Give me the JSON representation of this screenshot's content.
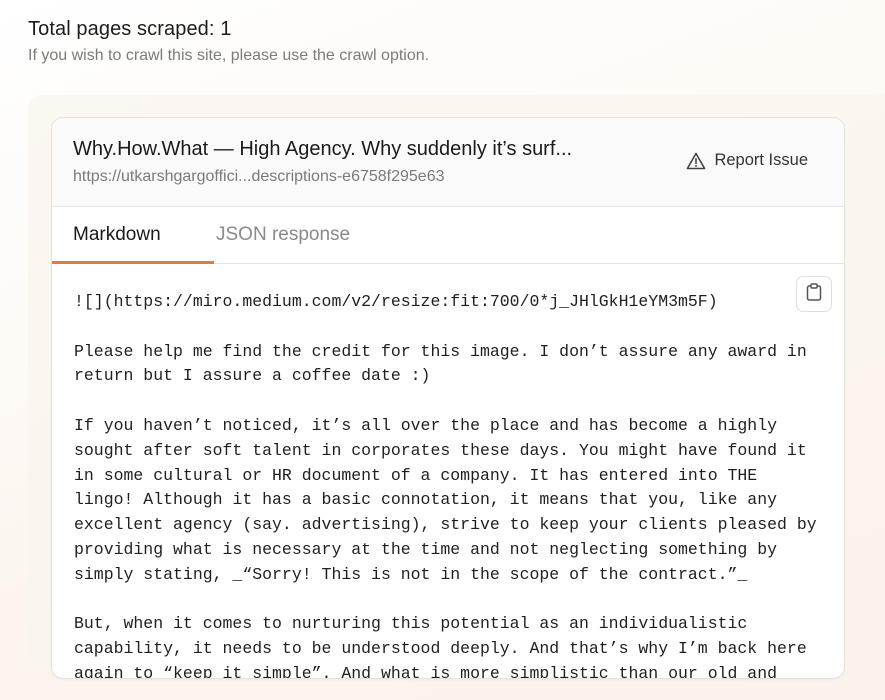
{
  "summary": {
    "title": "Total pages scraped: 1",
    "subtitle": "If you wish to crawl this site, please use the crawl option."
  },
  "result": {
    "page_title": "Why.How.What — High Agency. Why suddenly it’s surf...",
    "page_url": "https://utkarshgargoffici...descriptions-e6758f295e63",
    "report_label": "Report Issue"
  },
  "tabs": {
    "markdown": "Markdown",
    "json": "JSON response"
  },
  "markdown_lines": [
    "![](https://miro.medium.com/v2/resize:fit:700/0*j_JHlGkH1eYM3m5F)",
    "",
    "Please help me find the credit for this image. I don’t assure any award in",
    "return but I assure a coffee date :)",
    "",
    "If you haven’t noticed, it’s all over the place and has become a highly",
    "sought after soft talent in corporates these days. You might have found it",
    "in some cultural or HR document of a company. It has entered into THE",
    "lingo! Although it has a basic connotation, it means that you, like any",
    "excellent agency (say. advertising), strive to keep your clients pleased by",
    "providing what is necessary at the time and not neglecting something by",
    "simply stating, _“Sorry! This is not in the scope of the contract.”_",
    "",
    "But, when it comes to nurturing this potential as an individualistic",
    "capability, it needs to be understood deeply. And that’s why I’m back here",
    "again to “keep it simple”. And what is more simplistic than our old and"
  ],
  "icons": {
    "report": "warning-triangle-icon",
    "copy": "clipboard-icon"
  },
  "colors": {
    "active_tab_underline": "#e07b39",
    "muted_text": "#7b7b7b"
  }
}
